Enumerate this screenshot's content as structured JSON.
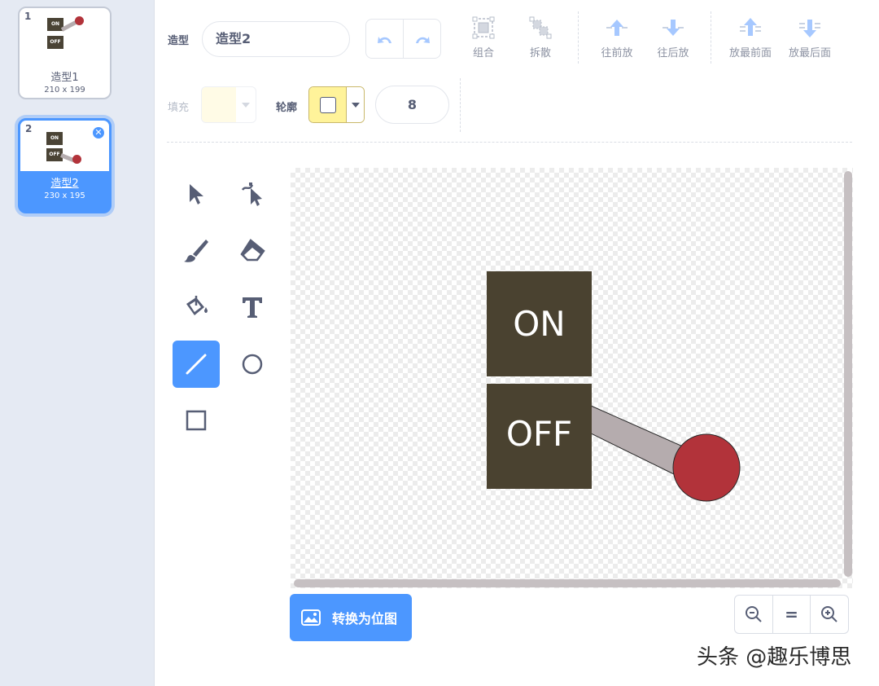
{
  "costumes": [
    {
      "number": "1",
      "name": "造型1",
      "size": "210 x 199",
      "selected": false
    },
    {
      "number": "2",
      "name": "造型2",
      "size": "230 x 195",
      "selected": true
    }
  ],
  "thumb_text": {
    "on": "ON",
    "off": "OFF"
  },
  "toolbar": {
    "costume_label": "造型",
    "costume_name": "造型2",
    "group_label": "组合",
    "ungroup_label": "拆散",
    "forward_label": "往前放",
    "backward_label": "往后放",
    "front_label": "放最前面",
    "back_label": "放最后面",
    "fill_label": "填充",
    "outline_label": "轮廓",
    "outline_width": "8"
  },
  "canvas": {
    "on_text": "ON",
    "off_text": "OFF"
  },
  "bottom": {
    "convert_label": "转换为位图",
    "zoom_reset": "="
  },
  "watermark": "头条 @趣乐博思",
  "colors": {
    "accent": "#4c97ff",
    "switch_box": "#4a4230",
    "knob": "#b2333a",
    "lever": "#b5acae",
    "outline_swatch": "#fff39a",
    "fill_swatch": "#fffbe6"
  },
  "icons": [
    "undo-icon",
    "redo-icon",
    "group-icon",
    "ungroup-icon",
    "forward-icon",
    "backward-icon",
    "front-icon",
    "back-icon",
    "select-icon",
    "reshape-icon",
    "brush-icon",
    "eraser-icon",
    "fill-icon",
    "text-icon",
    "line-icon",
    "circle-icon",
    "rectangle-icon",
    "zoom-out-icon",
    "zoom-in-icon",
    "image-icon"
  ]
}
